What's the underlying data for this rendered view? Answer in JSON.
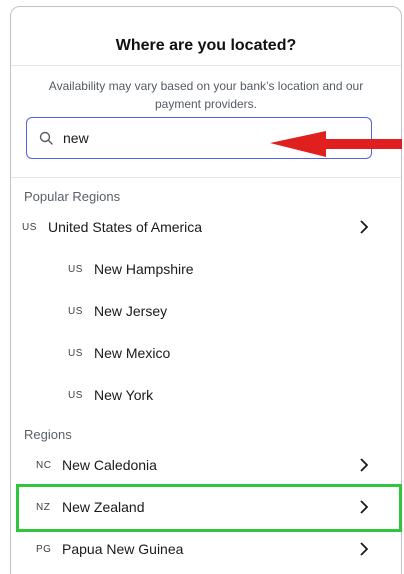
{
  "header": {
    "title": "Where are you located?",
    "subtitle": "Availability may vary based on your bank’s location and our payment providers."
  },
  "search": {
    "value": "new",
    "icon": "search-icon"
  },
  "sections": {
    "popular_label": "Popular Regions",
    "regions_label": "Regions"
  },
  "popular": [
    {
      "code": "US",
      "name": "United States of America",
      "has_children": true
    },
    {
      "code": "US",
      "name": "New Hampshire"
    },
    {
      "code": "US",
      "name": "New Jersey"
    },
    {
      "code": "US",
      "name": "New Mexico"
    },
    {
      "code": "US",
      "name": "New York"
    }
  ],
  "regions": [
    {
      "code": "NC",
      "name": "New Caledonia",
      "has_children": true
    },
    {
      "code": "NZ",
      "name": "New Zealand",
      "has_children": true,
      "highlighted": true
    },
    {
      "code": "PG",
      "name": "Papua New Guinea",
      "has_children": true
    }
  ],
  "colors": {
    "accent_border": "#5063e6",
    "arrow": "#e0201f",
    "highlight": "#2fc53c"
  }
}
